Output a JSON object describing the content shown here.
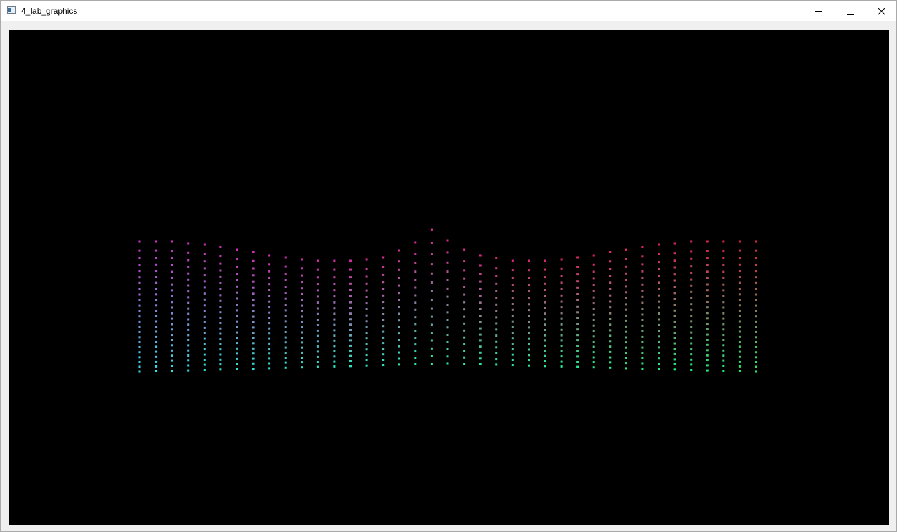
{
  "window": {
    "title": "4_lab_graphics",
    "controls": {
      "minimize_icon": "minimize-icon",
      "maximize_icon": "maximize-icon",
      "close_icon": "close-icon"
    }
  },
  "canvas": {
    "background": "#000000",
    "color_top_left": "#cc33cc",
    "color_top_right": "#dd2244",
    "color_bottom_left": "#33ddee",
    "color_bottom_right": "#22ee66"
  }
}
